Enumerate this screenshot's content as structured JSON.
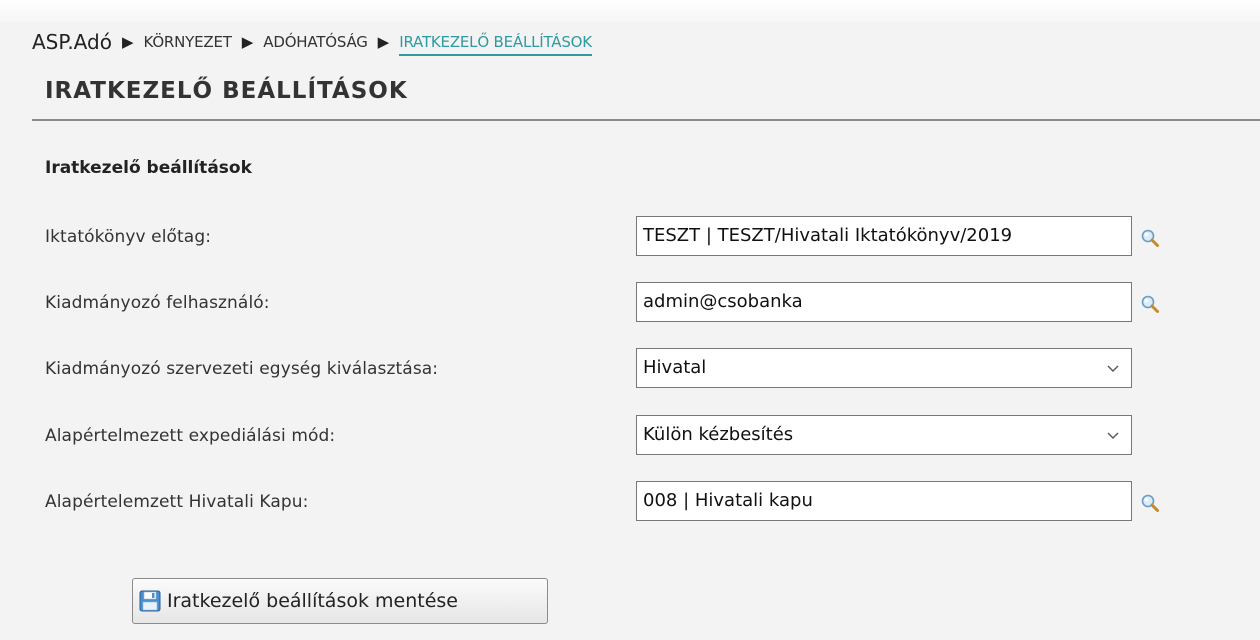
{
  "breadcrumb": {
    "home": "ASP.Adó",
    "items": [
      "KÖRNYEZET",
      "ADÓHATÓSÁG"
    ],
    "active": "IRATKEZELŐ BEÁLLÍTÁSOK"
  },
  "page": {
    "title": "IRATKEZELŐ BEÁLLÍTÁSOK",
    "section_title": "Iratkezelő beállítások"
  },
  "form": {
    "fields": [
      {
        "label": "Iktatókönyv előtag:",
        "value": "TESZT | TESZT/Hivatali Iktatókönyv/2019",
        "type": "lookup"
      },
      {
        "label": "Kiadmányozó felhasználó:",
        "value": "admin@csobanka",
        "type": "lookup"
      },
      {
        "label": "Kiadmányozó szervezeti egység kiválasztása:",
        "value": "Hivatal",
        "type": "select"
      },
      {
        "label": "Alapértelmezett expediálási mód:",
        "value": "Külön kézbesítés",
        "type": "select"
      },
      {
        "label": "Alapértelemzett Hivatali Kapu:",
        "value": "008 | Hivatali kapu",
        "type": "lookup"
      }
    ]
  },
  "actions": {
    "save_label": "Iratkezelő beállítások mentése"
  },
  "icons": {
    "breadcrumb_separator": "triangle-right-icon",
    "lookup": "magnifier-icon",
    "dropdown": "chevron-down-icon",
    "save": "floppy-disk-icon"
  },
  "colors": {
    "background": "#f3f3f3",
    "active_link": "#2f9aa0",
    "title_rule": "#8a8a8a"
  }
}
